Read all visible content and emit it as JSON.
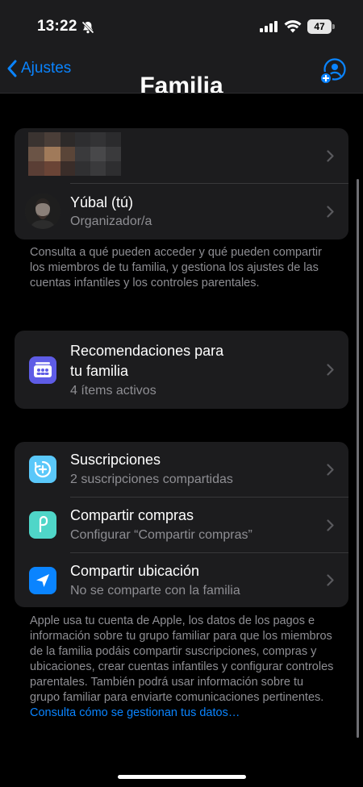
{
  "status_bar": {
    "time": "13:22",
    "battery": "47"
  },
  "nav": {
    "back_label": "Ajustes",
    "faded_title": "Familia"
  },
  "members": [
    {
      "name": "",
      "role": ""
    },
    {
      "name": "Yúbal (tú)",
      "role": "Organizador/a"
    }
  ],
  "members_footer": "Consulta a qué pueden acceder y qué pueden compartir los miembros de tu familia, y gestiona los ajustes de las cuentas infantiles y los controles parentales.",
  "recommendations": {
    "title_line1": "Recomendaciones para",
    "title_line2": "tu familia",
    "subtitle": "4 ítems activos"
  },
  "features": [
    {
      "title": "Suscripciones",
      "subtitle": "2 suscripciones compartidas",
      "icon": "subscriptions-icon",
      "color": "#5ac8fa"
    },
    {
      "title": "Compartir compras",
      "subtitle": "Configurar “Compartir compras”",
      "icon": "purchase-sharing-icon",
      "color": "#4fd6c8"
    },
    {
      "title": "Compartir ubicación",
      "subtitle": "No se comparte con la familia",
      "icon": "location-arrow-icon",
      "color": "#0a84ff"
    }
  ],
  "bottom_footer": "Apple usa tu cuenta de Apple, los datos de los pagos e información sobre tu grupo familiar para que los miembros de la familia podáis compartir suscripciones, compras y ubicaciones, crear cuentas infantiles y configurar controles parentales. También podrá usar información sobre tu grupo familiar para enviarte comunicaciones pertinentes.",
  "bottom_footer_link": "Consulta cómo se gestionan tus datos…",
  "colors": {
    "accent": "#0a84ff",
    "cell": "#1c1c1e",
    "secondary_text": "#8e8e93",
    "recommend_icon": "#5e5ce6"
  }
}
